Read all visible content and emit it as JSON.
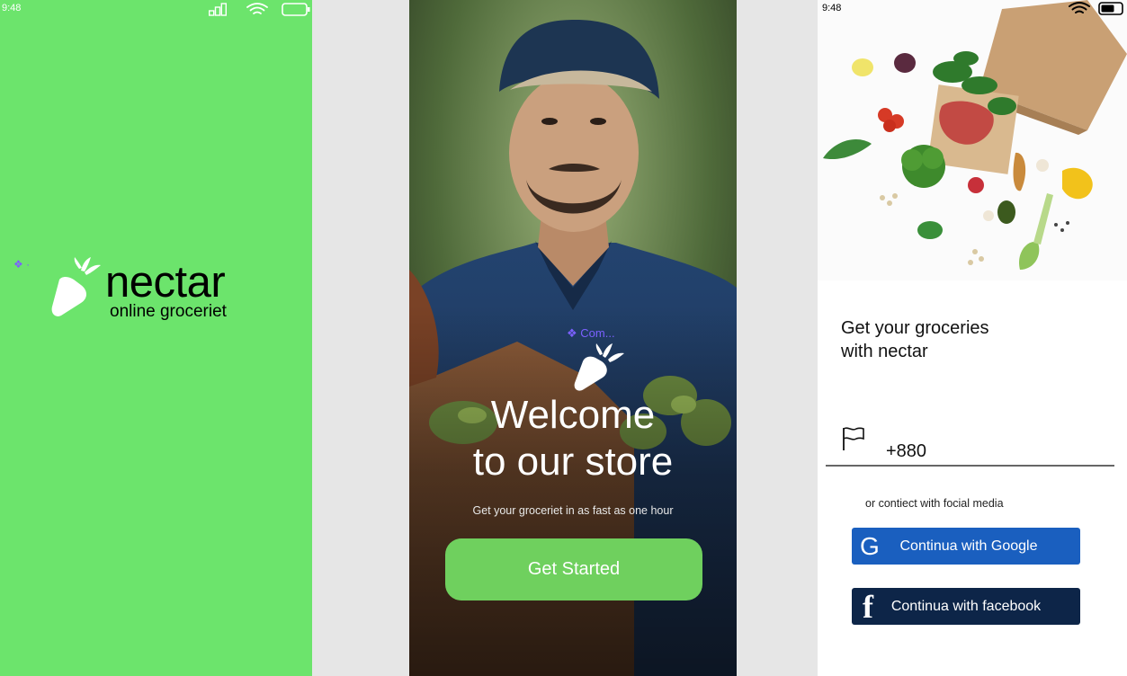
{
  "splash": {
    "status_time": "9:48",
    "brand_name": "nectar",
    "brand_tagline": "online groceriet",
    "background_color": "#6ce46c"
  },
  "welcome": {
    "component_label": "Com...",
    "title_line1": "Welcome",
    "title_line2": "to our store",
    "subtitle": "Get your groceriet in as fast as one hour",
    "button_label": "Get Started",
    "button_color": "#6fd05e"
  },
  "signin": {
    "status_time": "9:48",
    "title_line1": "Get your groceries",
    "title_line2": "with nectar",
    "phone_value": "+880",
    "social_caption": "or contiect with focial media",
    "google_label": "Continua with Google",
    "google_icon_glyph": "G",
    "google_color": "#1a5fbf",
    "facebook_label": "Continua  with facebook",
    "facebook_icon_glyph": "f",
    "facebook_color": "#0d2548"
  },
  "icons": [
    "signal-icon",
    "wifi-icon",
    "battery-icon",
    "carrot-logo-icon",
    "component-icon",
    "flag-icon",
    "google-icon",
    "facebook-icon"
  ]
}
